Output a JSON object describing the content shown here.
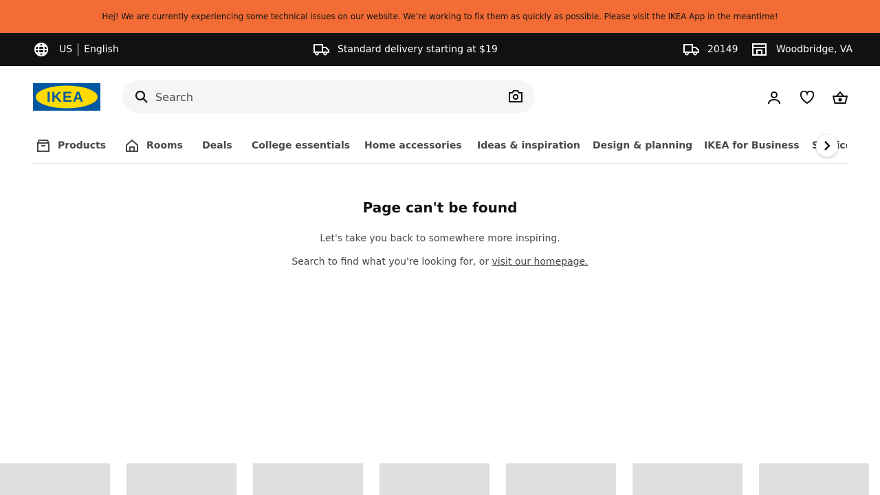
{
  "alert": {
    "text": "Hej! We are currently experiencing some technical issues on our website. We’re working to fix them as quickly as possible. Please visit the IKEA App in the meantime!"
  },
  "top_bar": {
    "country": "US",
    "language": "English",
    "delivery_text": "Standard delivery starting at $19",
    "zip": "20149",
    "store": "Woodbridge, VA"
  },
  "header": {
    "logo_text": "IKEA",
    "search_placeholder": "Search"
  },
  "nav": {
    "items": [
      {
        "label": "Products",
        "icon": "box-icon"
      },
      {
        "label": "Rooms",
        "icon": "house-icon"
      },
      {
        "label": "Deals"
      },
      {
        "label": "College essentials"
      },
      {
        "label": "Home accessories"
      },
      {
        "label": "Ideas & inspiration"
      },
      {
        "label": "Design & planning"
      },
      {
        "label": "IKEA for Business"
      },
      {
        "label": "Services"
      }
    ]
  },
  "main": {
    "heading": "Page can't be found",
    "line1": "Let's take you back to somewhere more inspiring.",
    "line2_prefix": "Search to find what you're looking for, or ",
    "homepage_link": "visit our homepage."
  },
  "colors": {
    "alert": "#f36c35",
    "top_bar": "#111111",
    "logo_blue": "#0058a3",
    "logo_yellow": "#ffdb00",
    "tile_placeholder": "#dfdfdf"
  }
}
